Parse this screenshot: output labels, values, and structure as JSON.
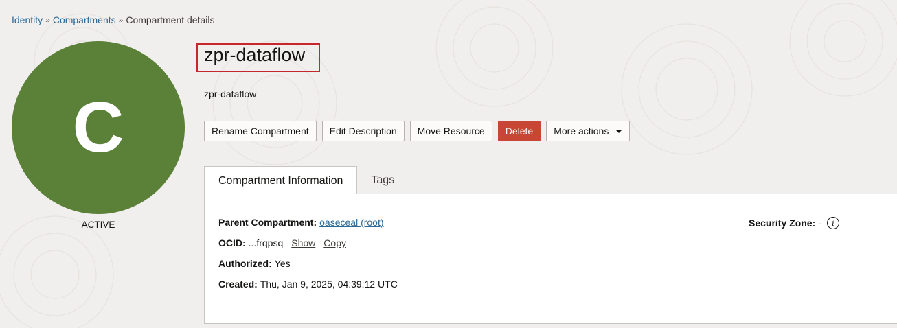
{
  "breadcrumb": {
    "items": [
      "Identity",
      "Compartments"
    ],
    "separator": "»",
    "current": "Compartment details"
  },
  "avatar": {
    "letter": "C",
    "color": "#5b8038"
  },
  "status": "ACTIVE",
  "compartment": {
    "title": "zpr-dataflow",
    "description": "zpr-dataflow"
  },
  "actions": {
    "rename": "Rename Compartment",
    "edit_description": "Edit Description",
    "move_resource": "Move Resource",
    "delete": "Delete",
    "more_actions": "More actions"
  },
  "tabs": [
    "Compartment Information",
    "Tags"
  ],
  "info": {
    "parent_label": "Parent Compartment:",
    "parent_value": "oaseceal (root)",
    "ocid_label": "OCID:",
    "ocid_value": "...frqpsq",
    "ocid_show": "Show",
    "ocid_copy": "Copy",
    "authorized_label": "Authorized:",
    "authorized_value": "Yes",
    "created_label": "Created:",
    "created_value": "Thu, Jan 9, 2025, 04:39:12 UTC",
    "security_zone_label": "Security Zone:",
    "security_zone_value": "-"
  },
  "icons": {
    "info": "info-icon",
    "caret": "chevron-down-icon"
  },
  "colors": {
    "link": "#2d6995",
    "delete": "#c74634",
    "highlight_box": "#c8262d"
  }
}
